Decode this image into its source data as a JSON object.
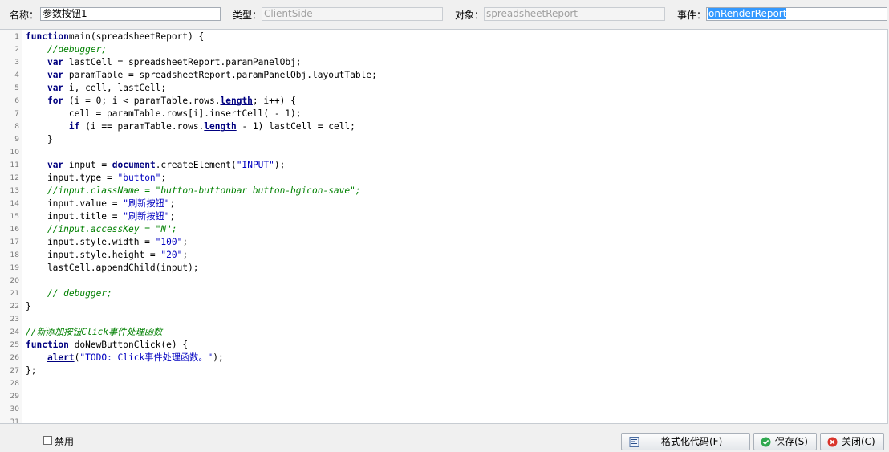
{
  "header": {
    "name_label": "名称：",
    "name_value": "参数按钮1",
    "type_label": "类型：",
    "type_value": "ClientSide",
    "object_label": "对象：",
    "object_value": "spreadsheetReport",
    "event_label": "事件：",
    "event_value": "onRenderReport"
  },
  "editor": {
    "line_numbers": [
      "1",
      "2",
      "3",
      "4",
      "5",
      "6",
      "7",
      "8",
      "9",
      "10",
      "11",
      "12",
      "13",
      "14",
      "15",
      "16",
      "17",
      "18",
      "19",
      "20",
      "21",
      "22",
      "23",
      "24",
      "25",
      "26",
      "27",
      "28",
      "29",
      "30",
      "31"
    ],
    "lines": [
      [
        [
          "kw",
          "function"
        ],
        [
          "",
          "main(spreadsheetReport) {"
        ]
      ],
      [
        [
          "",
          "    "
        ],
        [
          "cm",
          "//debugger;"
        ]
      ],
      [
        [
          "",
          "    "
        ],
        [
          "kw",
          "var"
        ],
        [
          "",
          " lastCell = spreadsheetReport.paramPanelObj;"
        ]
      ],
      [
        [
          "",
          "    "
        ],
        [
          "kw",
          "var"
        ],
        [
          "",
          " paramTable = spreadsheetReport.paramPanelObj.layoutTable;"
        ]
      ],
      [
        [
          "",
          "    "
        ],
        [
          "kw",
          "var"
        ],
        [
          "",
          " i, cell, lastCell;"
        ]
      ],
      [
        [
          "",
          "    "
        ],
        [
          "kw",
          "for"
        ],
        [
          "",
          " (i = 0; i < paramTable.rows."
        ],
        [
          "bi",
          "length"
        ],
        [
          "",
          "; i++) {"
        ]
      ],
      [
        [
          "",
          "        cell = paramTable.rows[i].insertCell( - 1);"
        ]
      ],
      [
        [
          "",
          "        "
        ],
        [
          "kw",
          "if"
        ],
        [
          "",
          " (i == paramTable.rows."
        ],
        [
          "bi",
          "length"
        ],
        [
          "",
          " - 1) lastCell = cell;"
        ]
      ],
      [
        [
          "",
          "    }"
        ]
      ],
      [],
      [
        [
          "",
          "    "
        ],
        [
          "kw",
          "var"
        ],
        [
          "",
          " input = "
        ],
        [
          "bi",
          "document"
        ],
        [
          "",
          ".createElement("
        ],
        [
          "st",
          "\"INPUT\""
        ],
        [
          "",
          ");"
        ]
      ],
      [
        [
          "",
          "    input.type = "
        ],
        [
          "st",
          "\"button\""
        ],
        [
          "",
          ";"
        ]
      ],
      [
        [
          "",
          "    "
        ],
        [
          "cm",
          "//input.className = \"button-buttonbar button-bgicon-save\";"
        ]
      ],
      [
        [
          "",
          "    input.value = "
        ],
        [
          "st",
          "\"刷新按钮\""
        ],
        [
          "",
          ";"
        ]
      ],
      [
        [
          "",
          "    input.title = "
        ],
        [
          "st",
          "\"刷新按钮\""
        ],
        [
          "",
          ";"
        ]
      ],
      [
        [
          "",
          "    "
        ],
        [
          "cm",
          "//input.accessKey = \"N\";"
        ]
      ],
      [
        [
          "",
          "    input.style.width = "
        ],
        [
          "st",
          "\"100\""
        ],
        [
          "",
          ";"
        ]
      ],
      [
        [
          "",
          "    input.style.height = "
        ],
        [
          "st",
          "\"20\""
        ],
        [
          "",
          ";"
        ]
      ],
      [
        [
          "",
          "    lastCell.appendChild(input);"
        ]
      ],
      [],
      [
        [
          "",
          "    "
        ],
        [
          "cm",
          "// debugger;"
        ]
      ],
      [
        [
          "",
          "}"
        ]
      ],
      [],
      [
        [
          "cm",
          "//新添加按钮Click事件处理函数"
        ]
      ],
      [
        [
          "kw",
          "function"
        ],
        [
          "",
          " doNewButtonClick(e) {"
        ]
      ],
      [
        [
          "",
          "    "
        ],
        [
          "bi",
          "alert"
        ],
        [
          "",
          "("
        ],
        [
          "st",
          "\"TODO: Click事件处理函数。\""
        ],
        [
          "",
          ");"
        ]
      ],
      [
        [
          "",
          "};"
        ]
      ],
      [],
      [],
      [],
      []
    ]
  },
  "footer": {
    "disable_label": "禁用",
    "format_button": "格式化代码(F)",
    "save_button": "保存(S)",
    "close_button": "关闭(C)"
  },
  "colors": {
    "keyword": "#000080",
    "comment": "#008000",
    "string": "#0000c0",
    "selection": "#3399ff",
    "save_icon": "#2fa84f",
    "close_icon": "#d9342b"
  },
  "icons": [
    "format-icon",
    "check-circle-icon",
    "close-circle-icon"
  ]
}
